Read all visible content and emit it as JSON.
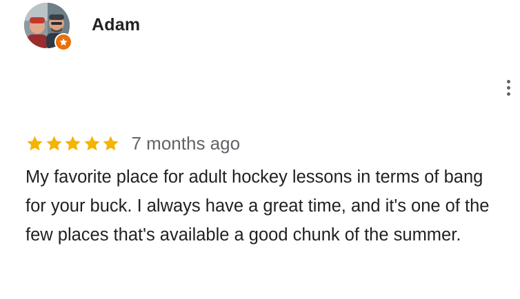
{
  "review": {
    "reviewer_name": "Adam",
    "avatar_icon": "profile-photo",
    "badge_icon": "local-guide-star-icon",
    "badge_color": "#e8710a",
    "rating": 5,
    "rating_max": 5,
    "star_color": "#f4b400",
    "time_ago": "7 months ago",
    "text": "My favorite place for adult hockey lessons in terms of bang for your buck. I always have a great time, and it's one of the few places that's available a good chunk of the summer.",
    "more_icon": "more-vertical-icon"
  }
}
